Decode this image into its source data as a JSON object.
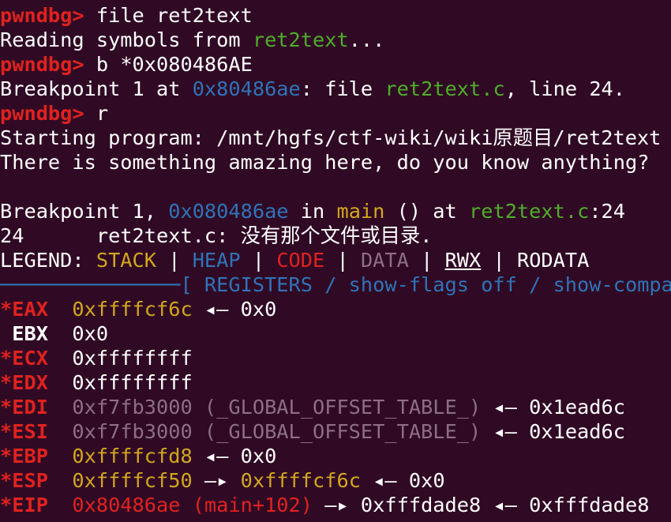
{
  "terminal": {
    "background": "#300a24",
    "lines": [
      {
        "segments": [
          {
            "t": "pwndbg>",
            "c": "#e0221f",
            "b": true
          },
          {
            "t": " file ret2text",
            "c": "#ffffff"
          }
        ]
      },
      {
        "segments": [
          {
            "t": "Reading symbols from ",
            "c": "#ffffff"
          },
          {
            "t": "ret2text",
            "c": "#4fad2a"
          },
          {
            "t": "...",
            "c": "#ffffff"
          }
        ]
      },
      {
        "segments": [
          {
            "t": "pwndbg>",
            "c": "#e0221f",
            "b": true
          },
          {
            "t": " b *0x080486AE",
            "c": "#ffffff"
          }
        ]
      },
      {
        "segments": [
          {
            "t": "Breakpoint 1 at ",
            "c": "#ffffff"
          },
          {
            "t": "0x80486ae",
            "c": "#2f73b8"
          },
          {
            "t": ": file ",
            "c": "#ffffff"
          },
          {
            "t": "ret2text.c",
            "c": "#4fad2a"
          },
          {
            "t": ", line 24.",
            "c": "#ffffff"
          }
        ]
      },
      {
        "segments": [
          {
            "t": "pwndbg>",
            "c": "#e0221f",
            "b": true
          },
          {
            "t": " r",
            "c": "#ffffff"
          }
        ]
      },
      {
        "segments": [
          {
            "t": "Starting program: /mnt/hgfs/ctf-wiki/wiki原题目/ret2text",
            "c": "#ffffff"
          }
        ]
      },
      {
        "segments": [
          {
            "t": "There is something amazing here, do you know anything?",
            "c": "#ffffff"
          }
        ]
      },
      {
        "segments": []
      },
      {
        "segments": [
          {
            "t": "Breakpoint 1, ",
            "c": "#ffffff"
          },
          {
            "t": "0x080486ae",
            "c": "#2f73b8"
          },
          {
            "t": " in ",
            "c": "#ffffff"
          },
          {
            "t": "main",
            "c": "#d2a71d"
          },
          {
            "t": " () at ",
            "c": "#ffffff"
          },
          {
            "t": "ret2text.c",
            "c": "#4fad2a"
          },
          {
            "t": ":24",
            "c": "#ffffff"
          }
        ]
      },
      {
        "segments": [
          {
            "t": "24      ret2text.c: 没有那个文件或目录.",
            "c": "#ffffff"
          }
        ]
      },
      {
        "segments": [
          {
            "t": "LEGEND: ",
            "c": "#ffffff"
          },
          {
            "t": "STACK",
            "c": "#d2a71d"
          },
          {
            "t": " | ",
            "c": "#ffffff"
          },
          {
            "t": "HEAP",
            "c": "#2f73b8"
          },
          {
            "t": " | ",
            "c": "#ffffff"
          },
          {
            "t": "CODE",
            "c": "#e0221f"
          },
          {
            "t": " | ",
            "c": "#ffffff"
          },
          {
            "t": "DATA",
            "c": "#8d6e86"
          },
          {
            "t": " | ",
            "c": "#ffffff"
          },
          {
            "t": "RWX",
            "c": "#ffffff",
            "u": true
          },
          {
            "t": " | RODATA",
            "c": "#ffffff"
          }
        ]
      },
      {
        "segments": [
          {
            "t": "───────────────[ REGISTERS / show-flags off / show-compact-",
            "c": "#2f73b8"
          }
        ]
      },
      {
        "segments": [
          {
            "t": "*EAX",
            "c": "#e0221f",
            "b": true
          },
          {
            "t": "  ",
            "c": "#ffffff"
          },
          {
            "t": "0xffffcf6c",
            "c": "#d2a71d"
          },
          {
            "t": " ◂— 0x0",
            "c": "#ffffff"
          }
        ]
      },
      {
        "segments": [
          {
            "t": " EBX",
            "c": "#ffffff",
            "b": true
          },
          {
            "t": "  0x0",
            "c": "#ffffff"
          }
        ]
      },
      {
        "segments": [
          {
            "t": "*ECX",
            "c": "#e0221f",
            "b": true
          },
          {
            "t": "  0xffffffff",
            "c": "#ffffff"
          }
        ]
      },
      {
        "segments": [
          {
            "t": "*EDX",
            "c": "#e0221f",
            "b": true
          },
          {
            "t": "  0xffffffff",
            "c": "#ffffff"
          }
        ]
      },
      {
        "segments": [
          {
            "t": "*EDI",
            "c": "#e0221f",
            "b": true
          },
          {
            "t": "  ",
            "c": "#ffffff"
          },
          {
            "t": "0xf7fb3000 (_GLOBAL_OFFSET_TABLE_)",
            "c": "#8d6e86"
          },
          {
            "t": " ◂— 0x1ead6c",
            "c": "#ffffff"
          }
        ]
      },
      {
        "segments": [
          {
            "t": "*ESI",
            "c": "#e0221f",
            "b": true
          },
          {
            "t": "  ",
            "c": "#ffffff"
          },
          {
            "t": "0xf7fb3000 (_GLOBAL_OFFSET_TABLE_)",
            "c": "#8d6e86"
          },
          {
            "t": " ◂— 0x1ead6c",
            "c": "#ffffff"
          }
        ]
      },
      {
        "segments": [
          {
            "t": "*EBP",
            "c": "#e0221f",
            "b": true
          },
          {
            "t": "  ",
            "c": "#ffffff"
          },
          {
            "t": "0xffffcfd8",
            "c": "#d2a71d"
          },
          {
            "t": " ◂— 0x0",
            "c": "#ffffff"
          }
        ]
      },
      {
        "segments": [
          {
            "t": "*ESP",
            "c": "#e0221f",
            "b": true
          },
          {
            "t": "  ",
            "c": "#ffffff"
          },
          {
            "t": "0xffffcf50",
            "c": "#d2a71d"
          },
          {
            "t": " —▸ ",
            "c": "#ffffff"
          },
          {
            "t": "0xffffcf6c",
            "c": "#d2a71d"
          },
          {
            "t": " ◂— 0x0",
            "c": "#ffffff"
          }
        ]
      },
      {
        "segments": [
          {
            "t": "*EIP",
            "c": "#e0221f",
            "b": true
          },
          {
            "t": "  ",
            "c": "#ffffff"
          },
          {
            "t": "0x80486ae (main+102)",
            "c": "#e0221f"
          },
          {
            "t": " —▸ 0xfffdade8 ◂— 0xfffdade8",
            "c": "#ffffff"
          }
        ]
      }
    ]
  }
}
